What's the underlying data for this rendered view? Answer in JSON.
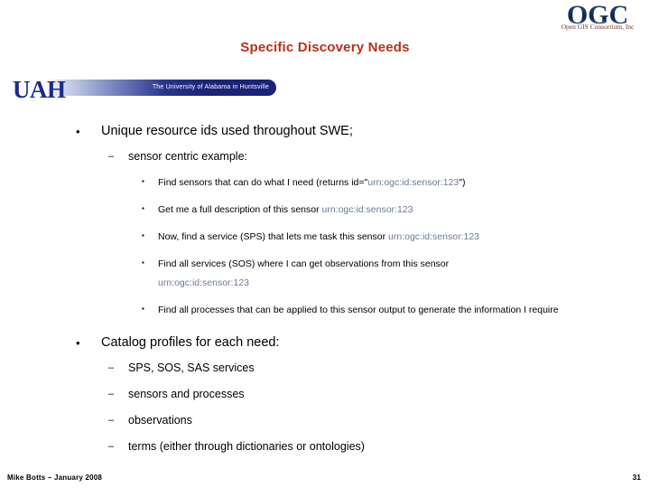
{
  "slide": {
    "title": "Specific Discovery Needs",
    "title_color": "#b5331a",
    "background_color": "#ffffff"
  },
  "ogc_logo": {
    "name": "ogc-logo",
    "letters": "OGC",
    "subtitle": "Open GIS Consortium, Inc",
    "letters_color": "#163560",
    "subtitle_color": "#6b3a2a"
  },
  "uah_logo": {
    "name": "uah-logo",
    "letters": "UAH",
    "banner_text": "The University of Alabama in Huntsville",
    "letters_color": "#1d2a8c",
    "banner_color": "#1a2378"
  },
  "bullets": {
    "markers": {
      "level1": "•",
      "level2": "–",
      "level3": "▪"
    },
    "items": [
      {
        "level": 1,
        "text": "Unique resource ids used throughout SWE;"
      },
      {
        "level": 2,
        "text": "sensor centric example:"
      },
      {
        "level": 3,
        "text_before": "Find sensors that can do what I need (returns id=\"",
        "urn": "urn:ogc:id:sensor:123",
        "text_after": "\")"
      },
      {
        "level": 3,
        "text_before": "Get me a full description of this sensor ",
        "urn": "urn:ogc:id:sensor:123",
        "text_after": ""
      },
      {
        "level": 3,
        "text_before": "Now, find a service (SPS) that lets me task this sensor ",
        "urn": "urn:ogc:id:sensor:123",
        "text_after": ""
      },
      {
        "level": 3,
        "text_before": "Find all services (SOS) where I can get observations from this sensor ",
        "urn": "urn:ogc:id:sensor:123",
        "text_after": ""
      },
      {
        "level": 3,
        "text_before": "Find all processes that can be applied to this sensor output to generate the information I require",
        "urn": "",
        "text_after": ""
      },
      {
        "level": 1,
        "text": "Catalog profiles for each need:"
      },
      {
        "level": 2,
        "text": "SPS, SOS, SAS services"
      },
      {
        "level": 2,
        "text": "sensors and processes"
      },
      {
        "level": 2,
        "text": "observations"
      },
      {
        "level": 2,
        "text": "terms (either through dictionaries or ontologies)"
      }
    ],
    "urn_color": "#6d7a95"
  },
  "footer": {
    "author_date": "Mike Botts – January 2008",
    "page_number": "31"
  }
}
